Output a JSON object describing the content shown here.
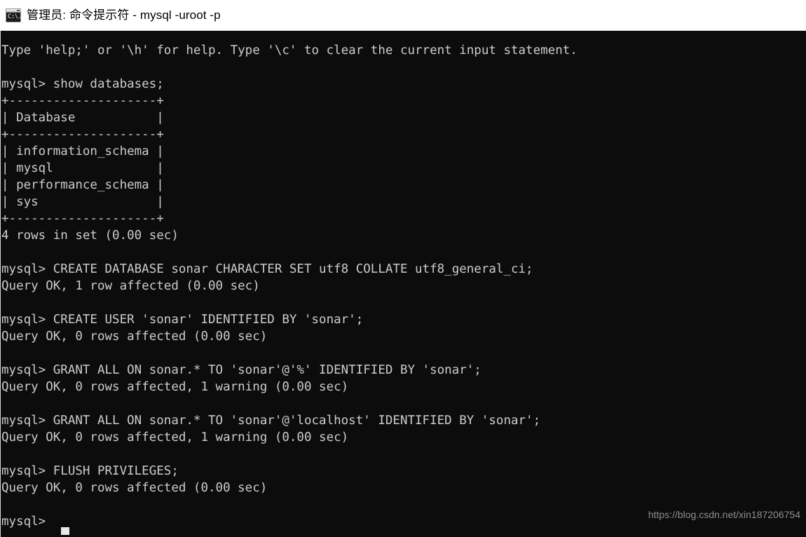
{
  "window": {
    "title": "管理员: 命令提示符 - mysql  -uroot -p",
    "icon_name": "cmd-console-icon",
    "icon_glyph": "C:\\.",
    "titlebar_bg": "#ffffff",
    "titlebar_fg": "#000000"
  },
  "console": {
    "background": "#0c0c0c",
    "foreground": "#cccccc",
    "rule_color": "#c2c7bd",
    "cursor": "block",
    "prompt": "mysql>",
    "lines": [
      "Type 'help;' or '\\h' for help. Type '\\c' to clear the current input statement.",
      "",
      "mysql> show databases;",
      "+--------------------+",
      "| Database           |",
      "+--------------------+",
      "| information_schema |",
      "| mysql              |",
      "| performance_schema |",
      "| sys                |",
      "+--------------------+",
      "4 rows in set (0.00 sec)",
      "",
      "mysql> CREATE DATABASE sonar CHARACTER SET utf8 COLLATE utf8_general_ci;",
      "Query OK, 1 row affected (0.00 sec)",
      "",
      "mysql> CREATE USER 'sonar' IDENTIFIED BY 'sonar';",
      "Query OK, 0 rows affected (0.00 sec)",
      "",
      "mysql> GRANT ALL ON sonar.* TO 'sonar'@'%' IDENTIFIED BY 'sonar';",
      "Query OK, 0 rows affected, 1 warning (0.00 sec)",
      "",
      "mysql> GRANT ALL ON sonar.* TO 'sonar'@'localhost' IDENTIFIED BY 'sonar';",
      "Query OK, 0 rows affected, 1 warning (0.00 sec)",
      "",
      "mysql> FLUSH PRIVILEGES;",
      "Query OK, 0 rows affected (0.00 sec)",
      "",
      "mysql>"
    ],
    "databases_table": {
      "header": "Database",
      "rows": [
        "information_schema",
        "mysql",
        "performance_schema",
        "sys"
      ],
      "summary": "4 rows in set (0.00 sec)"
    }
  },
  "watermark": {
    "text": "https://blog.csdn.net/xin187206754"
  }
}
